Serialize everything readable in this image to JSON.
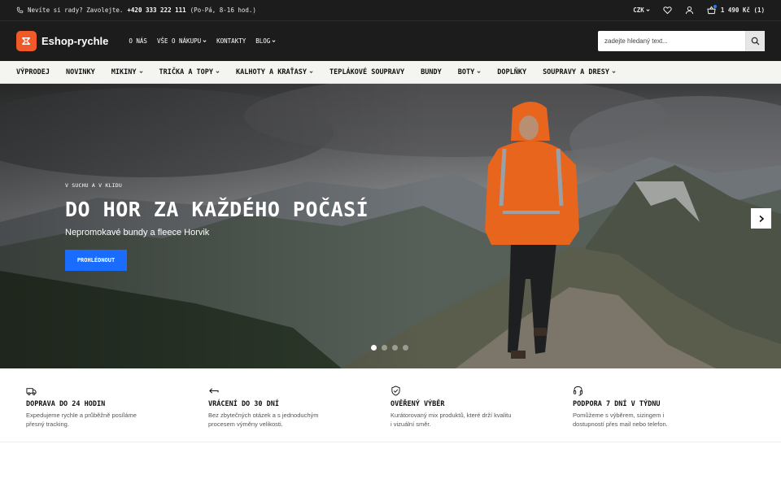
{
  "topbar": {
    "phone_text": "Nevíte si rady? Zavolejte.",
    "phone_number": "+420 333 222 111",
    "hours": "(Po-Pá, 8-16 hod.)",
    "currency": "CZK",
    "cart_label": "1 490 Kč (1)"
  },
  "header": {
    "logo_text": "Eshop-rychle",
    "nav": [
      {
        "label": "O NÁS"
      },
      {
        "label": "VŠE O NÁKUPU"
      },
      {
        "label": "KONTAKTY"
      },
      {
        "label": "BLOG"
      }
    ],
    "search_placeholder": "zadejte hledaný text..."
  },
  "categories": [
    {
      "label": "VÝPRODEJ"
    },
    {
      "label": "NOVINKY"
    },
    {
      "label": "MIKINY"
    },
    {
      "label": "TRIČKA A TOPY"
    },
    {
      "label": "KALHOTY A KRAŤASY"
    },
    {
      "label": "TEPLÁKOVÉ SOUPRAVY"
    },
    {
      "label": "BUNDY"
    },
    {
      "label": "BOTY"
    },
    {
      "label": "DOPLŇKY"
    },
    {
      "label": "SOUPRAVY A DRESY"
    }
  ],
  "hero": {
    "kicker": "V SUCHU A V KLIDU",
    "title": "DO HOR ZA KAŽDÉHO POČASÍ",
    "subtitle": "Nepromokavé bundy a fleece Horvik",
    "cta": "PROHLÉDNOUT",
    "slides_total": 4,
    "active_slide": 1
  },
  "benefits": [
    {
      "icon": "truck-icon",
      "title": "DOPRAVA DO 24 HODIN",
      "text": "Expedujeme rychle a průběžně posíláme přesný tracking."
    },
    {
      "icon": "return-arrow-icon",
      "title": "VRÁCENÍ DO 30 DNÍ",
      "text": "Bez zbytečných otázek a s jednoduchým procesem výměny velikosti."
    },
    {
      "icon": "shield-check-icon",
      "title": "OVĚŘENÝ VÝBĚR",
      "text": "Kurátorovaný mix produktů, které drží kvalitu i vizuální směr."
    },
    {
      "icon": "headset-icon",
      "title": "PODPORA 7 DNÍ V TÝDNU",
      "text": "Pomůžeme s výběrem, sizingem i dostupností přes mail nebo telefon."
    }
  ],
  "colors": {
    "dark_bg": "#1c1c1c",
    "brand_orange": "#f05a28",
    "cta_blue": "#1a6cff"
  }
}
